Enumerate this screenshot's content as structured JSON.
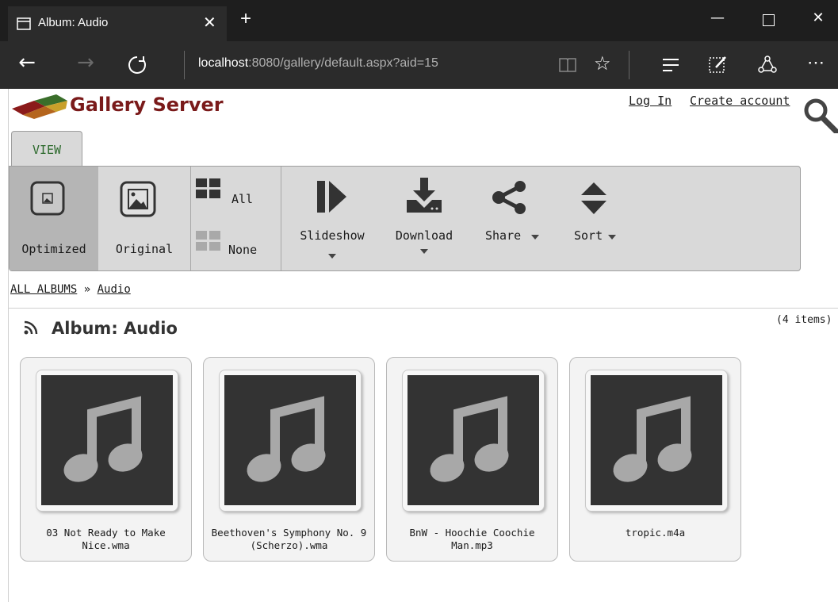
{
  "browser": {
    "tab_title": "Album: Audio",
    "address_host": "localhost",
    "address_rest": ":8080/gallery/default.aspx?aid=15"
  },
  "header": {
    "logo_text": "Gallery Server",
    "login_label": "Log In",
    "create_account_label": "Create account"
  },
  "toolbar": {
    "view_tab": "VIEW",
    "optimized_label": "Optimized",
    "original_label": "Original",
    "select_all_label": "All",
    "select_none_label": "None",
    "slideshow_label": "Slideshow",
    "download_label": "Download",
    "share_label": "Share",
    "sort_label": "Sort"
  },
  "breadcrumb": {
    "root": "ALL ALBUMS",
    "separator": "»",
    "current": "Audio"
  },
  "album": {
    "title": "Album: Audio",
    "item_count": "(4 items)",
    "items": [
      {
        "title": "03 Not Ready to Make Nice.wma"
      },
      {
        "title": "Beethoven's Symphony No. 9 (Scherzo).wma"
      },
      {
        "title": "BnW - Hoochie Coochie Man.mp3"
      },
      {
        "title": "tropic.m4a"
      }
    ]
  },
  "colors": {
    "chrome_dark": "#1e1e1e",
    "chrome_mid": "#2b2b2b",
    "toolbar_bg": "#d9d9d9",
    "toolbar_selected": "#b5b5b5",
    "logo_text": "#7a1a1a",
    "view_tab_text": "#2d6a2d",
    "thumb_bg": "#333333",
    "note_color": "#a8a8a8"
  }
}
